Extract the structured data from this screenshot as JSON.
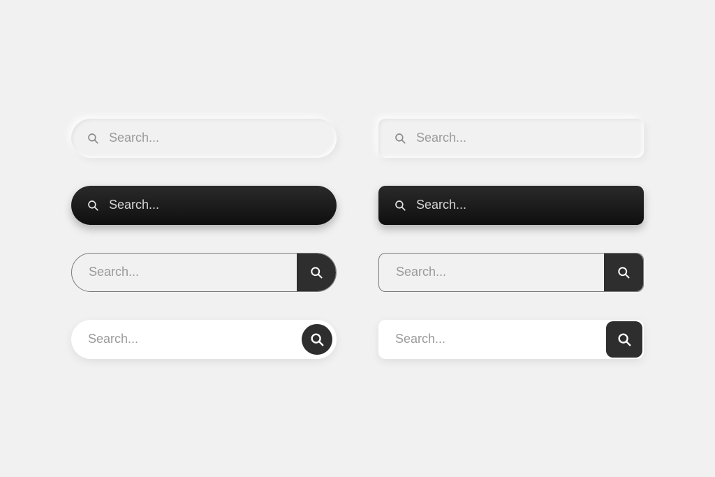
{
  "placeholder": "Search...",
  "colors": {
    "background": "#f1f1f1",
    "dark": "#2e2e2e",
    "placeholder_light": "#9a9a9a",
    "placeholder_dark": "#d6d6d6",
    "border": "#7a7a7a",
    "white": "#ffffff"
  },
  "variants": [
    {
      "id": "neumorph-pill",
      "shape": "pill",
      "theme": "light",
      "icon_position": "left"
    },
    {
      "id": "neumorph-soft",
      "shape": "soft",
      "theme": "light",
      "icon_position": "left"
    },
    {
      "id": "dark-pill",
      "shape": "pill",
      "theme": "dark",
      "icon_position": "left"
    },
    {
      "id": "dark-soft",
      "shape": "soft",
      "theme": "dark",
      "icon_position": "left"
    },
    {
      "id": "bordered-pill",
      "shape": "pill",
      "theme": "bordered",
      "icon_position": "right-button"
    },
    {
      "id": "bordered-soft",
      "shape": "soft",
      "theme": "bordered",
      "icon_position": "right-button"
    },
    {
      "id": "white-pill",
      "shape": "pill",
      "theme": "white",
      "icon_position": "right-circle"
    },
    {
      "id": "white-soft",
      "shape": "soft",
      "theme": "white",
      "icon_position": "right-square"
    }
  ]
}
